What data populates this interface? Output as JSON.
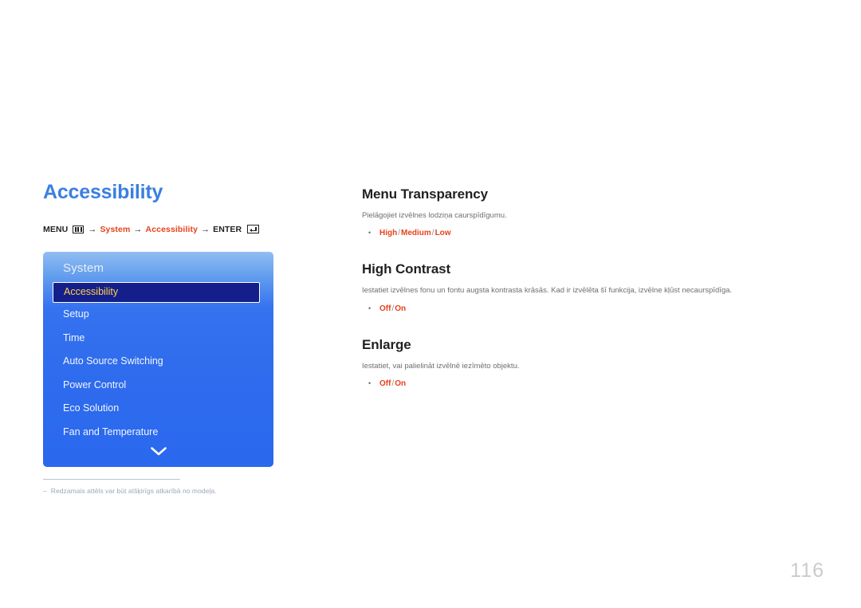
{
  "page": {
    "title": "Accessibility",
    "number": "116"
  },
  "breadcrumb": {
    "menu_label": "MENU",
    "menu_icon": "menu-grid-icon",
    "arrow": "→",
    "step1": "System",
    "step2": "Accessibility",
    "enter_label": "ENTER",
    "enter_icon": "enter-return-icon"
  },
  "osd": {
    "title": "System",
    "items": [
      {
        "label": "Accessibility",
        "selected": true
      },
      {
        "label": "Setup",
        "selected": false
      },
      {
        "label": "Time",
        "selected": false
      },
      {
        "label": "Auto Source Switching",
        "selected": false
      },
      {
        "label": "Power Control",
        "selected": false
      },
      {
        "label": "Eco Solution",
        "selected": false
      },
      {
        "label": "Fan and Temperature",
        "selected": false
      }
    ],
    "scroll_icon": "chevron-down-icon"
  },
  "footnote": {
    "dash": "–",
    "text": "Redzamais attēls var būt atšķirīgs atkarībā no modeļa."
  },
  "sections": [
    {
      "heading": "Menu Transparency",
      "description": "Pielāgojiet izvēlnes lodziņa caurspīdīgumu.",
      "bullet": "•",
      "options": [
        "High",
        "Medium",
        "Low"
      ],
      "separator": "/"
    },
    {
      "heading": "High Contrast",
      "description": "Iestatiet izvēlnes fonu un fontu augsta kontrasta krāsās. Kad ir izvēlēta šī funkcija, izvēlne kļūst necaurspīdīga.",
      "bullet": "•",
      "options": [
        "Off",
        "On"
      ],
      "separator": "/"
    },
    {
      "heading": "Enlarge",
      "description": "Iestatiet, vai palielināt izvēlnē iezīmēto objektu.",
      "bullet": "•",
      "options": [
        "Off",
        "On"
      ],
      "separator": "/"
    }
  ],
  "colors": {
    "title_blue": "#3b7fe0",
    "accent_red": "#e8411c",
    "osd_blue": "#2e6bee",
    "osd_selected_bg": "#141f8c",
    "osd_selected_text": "#ffd24a",
    "body_gray": "#6d6e71",
    "footnote_gray": "#9aa8bb",
    "page_number_gray": "#c9cbcd"
  }
}
